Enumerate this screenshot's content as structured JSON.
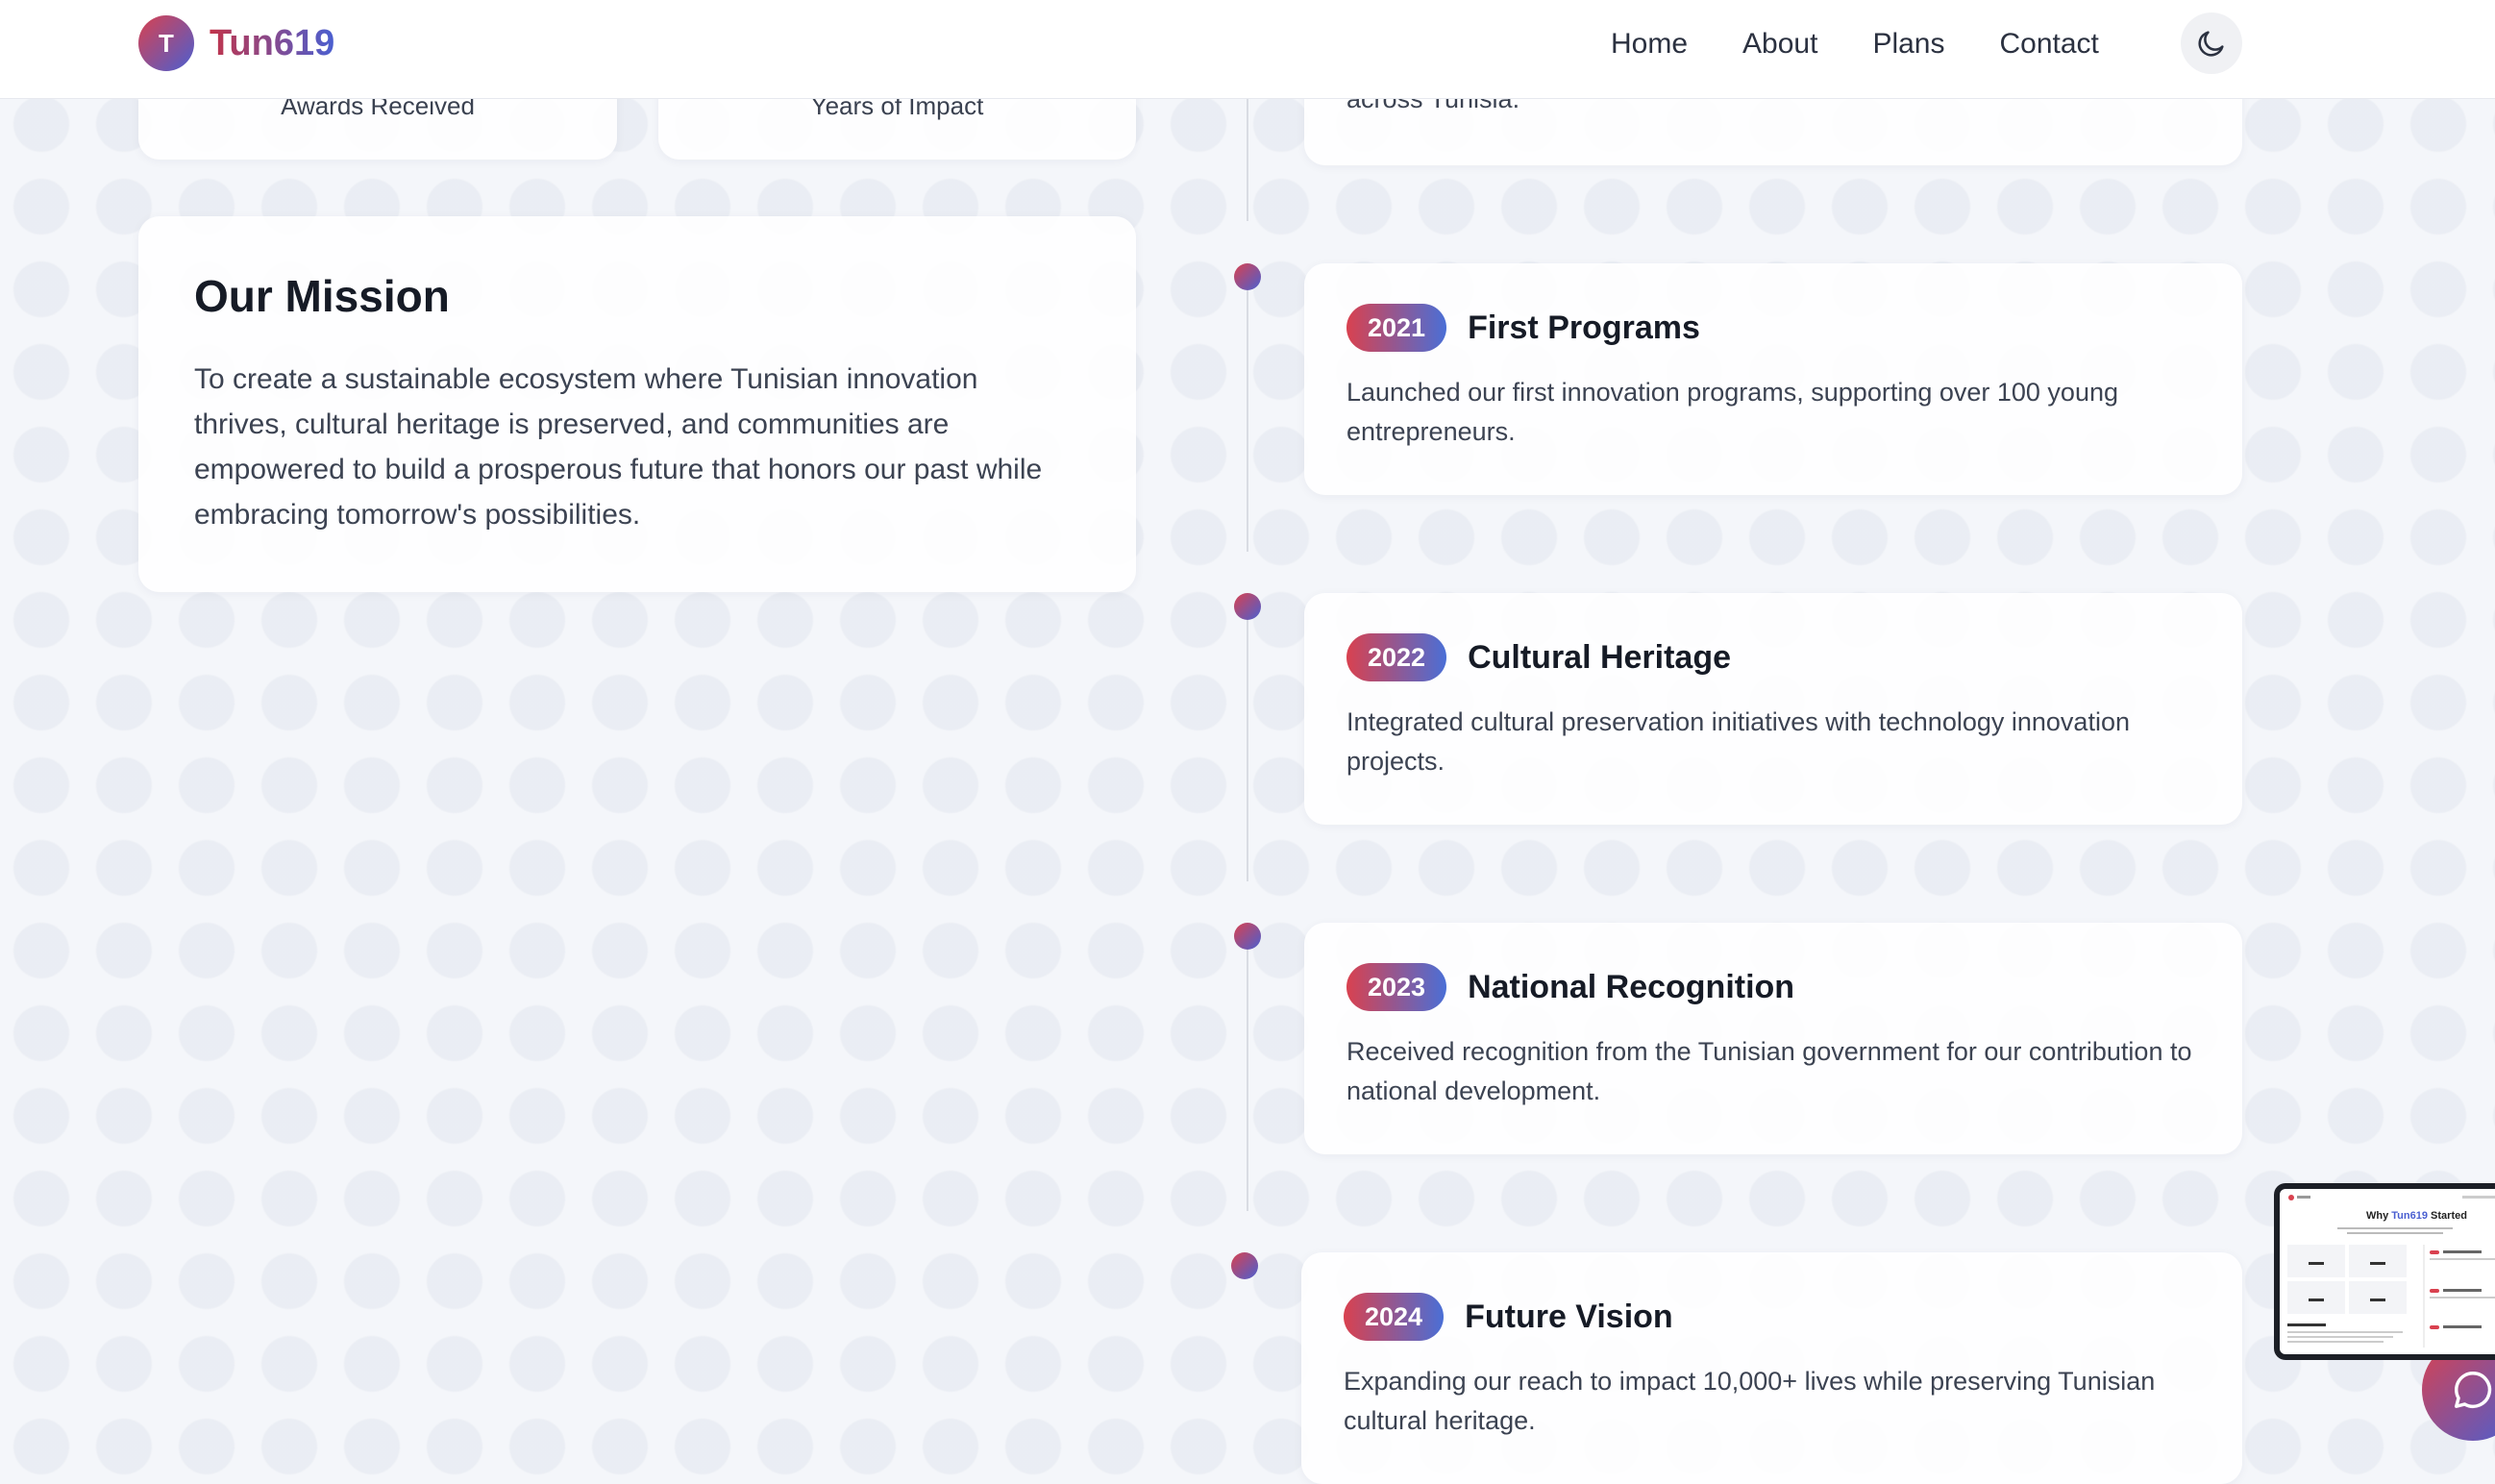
{
  "header": {
    "logo_letter": "T",
    "brand": "Tun619",
    "nav": [
      "Home",
      "About",
      "Plans",
      "Contact"
    ],
    "theme_toggle_icon": "moon-icon"
  },
  "stats": [
    {
      "label": "Awards Received"
    },
    {
      "label": "Years of Impact"
    }
  ],
  "partial_event_text": "across Tunisia.",
  "mission": {
    "title": "Our Mission",
    "text": "To create a sustainable ecosystem where Tunisian innovation thrives, cultural heritage is preserved, and communities are empowered to build a prosperous future that honors our past while embracing tomorrow's possibilities."
  },
  "timeline": [
    {
      "year": "2021",
      "title": "First Programs",
      "text": "Launched our first innovation programs, supporting over 100 young entrepreneurs."
    },
    {
      "year": "2022",
      "title": "Cultural Heritage",
      "text": "Integrated cultural preservation initiatives with technology innovation projects."
    },
    {
      "year": "2023",
      "title": "National Recognition",
      "text": "Received recognition from the Tunisian government for our contribution to national development."
    },
    {
      "year": "2024",
      "title": "Future Vision",
      "text": "Expanding our reach to impact 10,000+ lives while preserving Tunisian cultural heritage."
    }
  ],
  "preview": {
    "title_prefix": "Why ",
    "title_brand": "Tun619",
    "title_suffix": " Started"
  },
  "chat_icon": "chat-bubble-icon",
  "colors": {
    "gradient_start": "#d9414f",
    "gradient_end": "#4a5fd1"
  }
}
